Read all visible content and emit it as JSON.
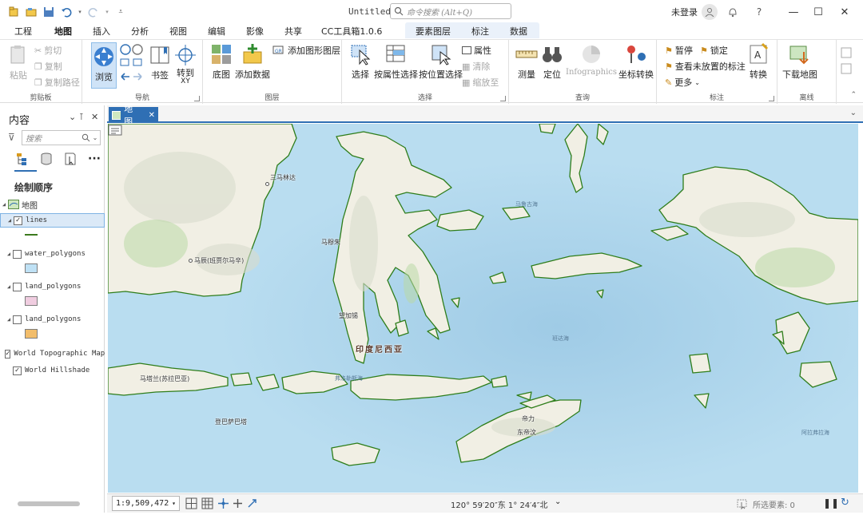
{
  "window": {
    "title": "Untitled",
    "search_placeholder": "命令搜索 (Alt+Q)",
    "user_label": "未登录"
  },
  "ribbon_tabs": [
    "工程",
    "地图",
    "插入",
    "分析",
    "视图",
    "编辑",
    "影像",
    "共享",
    "CC工具箱1.0.6",
    "要素图层",
    "标注",
    "数据"
  ],
  "active_tab": "地图",
  "ribbon": {
    "clipboard": {
      "label": "剪贴板",
      "paste": "粘贴",
      "cut": "剪切",
      "copy": "复制",
      "copy_path": "复制路径"
    },
    "navigate": {
      "label": "导航",
      "explore": "浏览",
      "bookmarks": "书签",
      "goto_xy": "转到",
      "goto_xy2": "XY"
    },
    "layer": {
      "label": "图层",
      "basemap": "底图",
      "add_data": "添加数据",
      "add_graphics_layer": "添加图形图层"
    },
    "selection": {
      "label": "选择",
      "select": "选择",
      "select_by_attr": "按属性选择",
      "select_by_loc": "按位置选择",
      "attributes": "属性",
      "clear": "清除",
      "zoom_to": "缩放至"
    },
    "inquiry": {
      "label": "查询",
      "measure": "测量",
      "locate": "定位",
      "infographics": "Infographics",
      "convert_coords": "坐标转换"
    },
    "labeling": {
      "label": "标注",
      "pause": "暂停",
      "lock": "锁定",
      "view_unplaced": "查看未放置的标注",
      "more": "更多",
      "convert": "转换"
    },
    "offline": {
      "label": "离线",
      "download_map": "下载地图"
    }
  },
  "contents": {
    "title": "内容",
    "search_placeholder": "搜索",
    "draw_order_label": "绘制顺序",
    "map_name": "地图",
    "layers": [
      {
        "name": "lines",
        "checked": true,
        "symbol": "line",
        "color": "#3c7a1e",
        "selected": true
      },
      {
        "name": "water_polygons",
        "checked": false,
        "symbol": "fill",
        "color": "#bfe1f5"
      },
      {
        "name": "land_polygons",
        "checked": false,
        "symbol": "fill",
        "color": "#f0cde0"
      },
      {
        "name": "land_polygons",
        "checked": false,
        "symbol": "fill",
        "color": "#f2bd6b"
      },
      {
        "name": "World Topographic Map",
        "checked": true,
        "symbol": "none"
      },
      {
        "name": "World Hillshade",
        "checked": true,
        "symbol": "none"
      }
    ]
  },
  "map_view": {
    "tab_label": "地图",
    "labels": {
      "samarinda": "三马林达",
      "balikpapan": "马辰(班贾尔马辛)",
      "mamuju": "马穆朱",
      "makassar": "望加锡",
      "indonesia": "印度尼西亚",
      "maluku_sea": "马鲁古海",
      "banda_sea": "班达海",
      "flores_sea": "弗洛勒斯海",
      "mataram": "马塔兰(苏拉巴亚)",
      "bima": "登巴萨巴塔",
      "dili": "帝力",
      "east_timor": "东帝汶",
      "arafura_sea": "阿拉弗拉海"
    }
  },
  "status": {
    "scale": "1:9,509,472",
    "coordinates": "120° 59′20″东  1° 24′4″北",
    "selected_features": "所选要素: 0"
  },
  "colors": {
    "accent": "#2f6fb4",
    "sea": "#b9ddf0",
    "land": "#f1efe4",
    "coast": "#2e7d1a"
  }
}
